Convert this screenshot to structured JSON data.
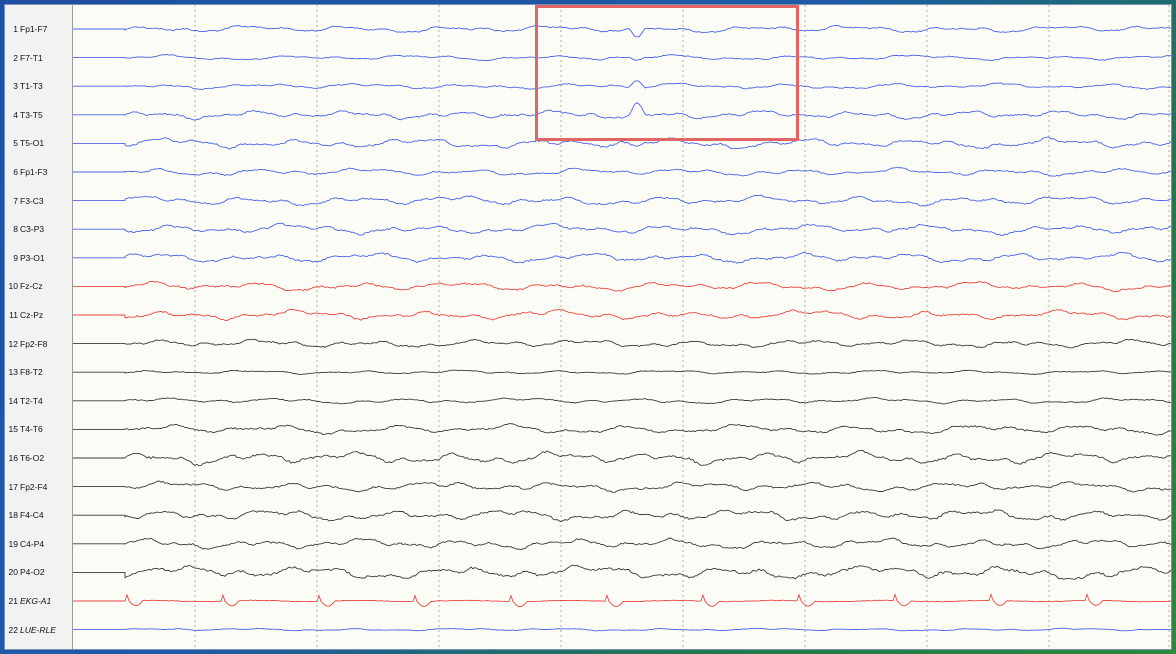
{
  "channels": [
    {
      "num": "1",
      "label": "Fp1-F7",
      "color": "#4a63e8",
      "amp": 3.2,
      "seed": 11
    },
    {
      "num": "2",
      "label": "F7-T1",
      "color": "#4a63e8",
      "amp": 2.4,
      "seed": 23
    },
    {
      "num": "3",
      "label": "T1-T3",
      "color": "#4a63e8",
      "amp": 2.6,
      "seed": 37
    },
    {
      "num": "4",
      "label": "T3-T5",
      "color": "#4a63e8",
      "amp": 3.8,
      "seed": 41
    },
    {
      "num": "5",
      "label": "T5-O1",
      "color": "#4a63e8",
      "amp": 4.6,
      "seed": 53
    },
    {
      "num": "6",
      "label": "Fp1-F3",
      "color": "#4a63e8",
      "amp": 3.4,
      "seed": 67
    },
    {
      "num": "7",
      "label": "F3-C3",
      "color": "#4a63e8",
      "amp": 4.2,
      "seed": 71
    },
    {
      "num": "8",
      "label": "C3-P3",
      "color": "#4a63e8",
      "amp": 4.6,
      "seed": 83
    },
    {
      "num": "9",
      "label": "P3-O1",
      "color": "#4a63e8",
      "amp": 4.4,
      "seed": 97
    },
    {
      "num": "10",
      "label": "Fz-Cz",
      "color": "#e8473f",
      "amp": 4.0,
      "seed": 101
    },
    {
      "num": "11",
      "label": "Cz-Pz",
      "color": "#e8473f",
      "amp": 4.4,
      "seed": 113
    },
    {
      "num": "12",
      "label": "Fp2-F8",
      "color": "#3a3a3a",
      "amp": 3.6,
      "seed": 127
    },
    {
      "num": "13",
      "label": "F8-T2",
      "color": "#3a3a3a",
      "amp": 1.8,
      "seed": 131
    },
    {
      "num": "14",
      "label": "T2-T4",
      "color": "#3a3a3a",
      "amp": 2.6,
      "seed": 149
    },
    {
      "num": "15",
      "label": "T4-T6",
      "color": "#3a3a3a",
      "amp": 4.2,
      "seed": 151
    },
    {
      "num": "16",
      "label": "T6-O2",
      "color": "#3a3a3a",
      "amp": 5.6,
      "seed": 163
    },
    {
      "num": "17",
      "label": "Fp2-F4",
      "color": "#3a3a3a",
      "amp": 4.4,
      "seed": 173
    },
    {
      "num": "18",
      "label": "F4-C4",
      "color": "#3a3a3a",
      "amp": 5.2,
      "seed": 181
    },
    {
      "num": "19",
      "label": "C4-P4",
      "color": "#3a3a3a",
      "amp": 4.6,
      "seed": 191
    },
    {
      "num": "20",
      "label": "P4-O2",
      "color": "#3a3a3a",
      "amp": 6.2,
      "seed": 199
    },
    {
      "num": "21",
      "label": "EKG-A1",
      "color": "#e8473f",
      "amp": 1.0,
      "seed": 211,
      "type": "ekg",
      "italic": true
    },
    {
      "num": "22",
      "label": "LUE-RLE",
      "color": "#4a63e8",
      "amp": 1.2,
      "seed": 223,
      "italic": true
    }
  ],
  "colors": {
    "background": "#fcfcf6",
    "grid": "#8a8a8a",
    "selection": "#e06666"
  }
}
